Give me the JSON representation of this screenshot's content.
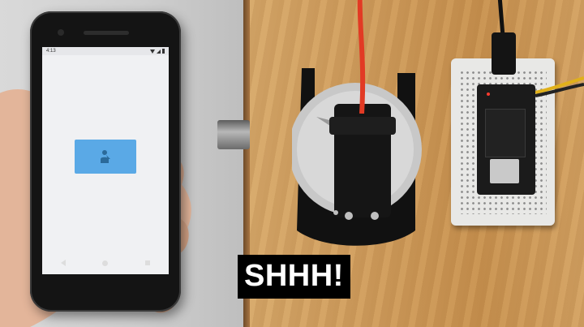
{
  "caption": {
    "text": "SHHH!"
  },
  "phone": {
    "status_time": "4:13",
    "unlock_button": {
      "icon": "person-unlock-icon"
    },
    "nav": {
      "back_icon": "back-icon",
      "home_icon": "home-icon",
      "recents_icon": "recents-icon"
    }
  },
  "colors": {
    "button_blue": "#5aa9e6",
    "screen_bg": "#f0f1f3",
    "servo_wire": "#e23a24",
    "wood": "#cf9c5c"
  }
}
